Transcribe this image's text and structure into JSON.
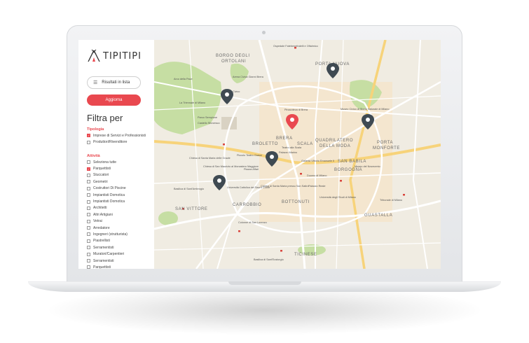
{
  "brand": {
    "logo_text": "TIPITIPI"
  },
  "sidebar": {
    "list_button": "Risultati in lista",
    "update_button": "Aggiorna",
    "filter_title": "Filtra per",
    "tipologia": {
      "title": "Tipologia",
      "options": [
        {
          "label": "Imprese di Servizi e Professionisti",
          "checked": true
        },
        {
          "label": "Produttori/Rivenditore",
          "checked": false
        }
      ]
    },
    "attivita": {
      "title": "Attività",
      "options": [
        {
          "label": "Seleziona tutte",
          "checked": false
        },
        {
          "label": "Parquettisti",
          "checked": true
        },
        {
          "label": "Stuccatori",
          "checked": false
        },
        {
          "label": "Geometri",
          "checked": false
        },
        {
          "label": "Costruttori Di Piscine",
          "checked": false
        },
        {
          "label": "Impiantisti Domotica",
          "checked": false
        },
        {
          "label": "Impiantisti Domotica",
          "checked": false
        },
        {
          "label": "Architetti",
          "checked": false
        },
        {
          "label": "Altri Artigiani",
          "checked": false
        },
        {
          "label": "Vetrai",
          "checked": false
        },
        {
          "label": "Arredatore",
          "checked": false
        },
        {
          "label": "Ingegneri (strutturista)",
          "checked": false
        },
        {
          "label": "Piastrellisti",
          "checked": false
        },
        {
          "label": "Serramentisti",
          "checked": false
        },
        {
          "label": "Muratori/Carpentieri",
          "checked": false
        },
        {
          "label": "Serramentisti",
          "checked": false
        },
        {
          "label": "Parquettisti",
          "checked": false
        }
      ]
    }
  },
  "map": {
    "districts": [
      "BORGO DEGLI",
      "ORTOLANI",
      "PORTA NUOVA",
      "BRERA",
      "BROLETTO",
      "SCALA",
      "QUADRILATERO",
      "DELLA MODA",
      "PORTA",
      "MONFORTE",
      "SAN BABILA",
      "BORGOGNA",
      "SAN VITTORE",
      "CARROBBIO",
      "BOTTONUTI",
      "GUASTALLA",
      "TICINESE"
    ],
    "places": [
      "Ospedale Fatebenefratelli e Oftalmico",
      "Arena Civica Gianni Brera",
      "Arco della Pace",
      "Acquario Civico",
      "La Triennale di Milano",
      "Arco della Pace",
      "Parco Sempione",
      "Castello Sforzesco",
      "Pinacoteca di Brera",
      "Museo Civico di Storia Naturale di Milano",
      "Teatro alla Scala",
      "Palazzo Marino",
      "Piccolo Teatro Grassi",
      "Chiesa di Santa Maria delle Grazie",
      "Chiesa di San Maurizio al Monastero Maggiore",
      "Piazza Affari",
      "Galleria Vittorio Emanuele II",
      "Duomo di Milano",
      "Palazzo Reale",
      "Basilica di Sant'Ambrogio",
      "Università Cattolica del Sacro Cuore",
      "Chiesa di Santa Maria presso San Satiro",
      "Università degli Studi di Milano",
      "Tribunale di Milano",
      "Colonne di San Lorenzo",
      "Basilica di Sant'Eustorgio",
      "Museo del Novecento"
    ],
    "pin_count": 6
  },
  "colors": {
    "accent": "#e9484f",
    "park": "#c6dea3",
    "pin": "#3f4a52",
    "road": "#ffffff",
    "major_road": "#f7d37a"
  }
}
